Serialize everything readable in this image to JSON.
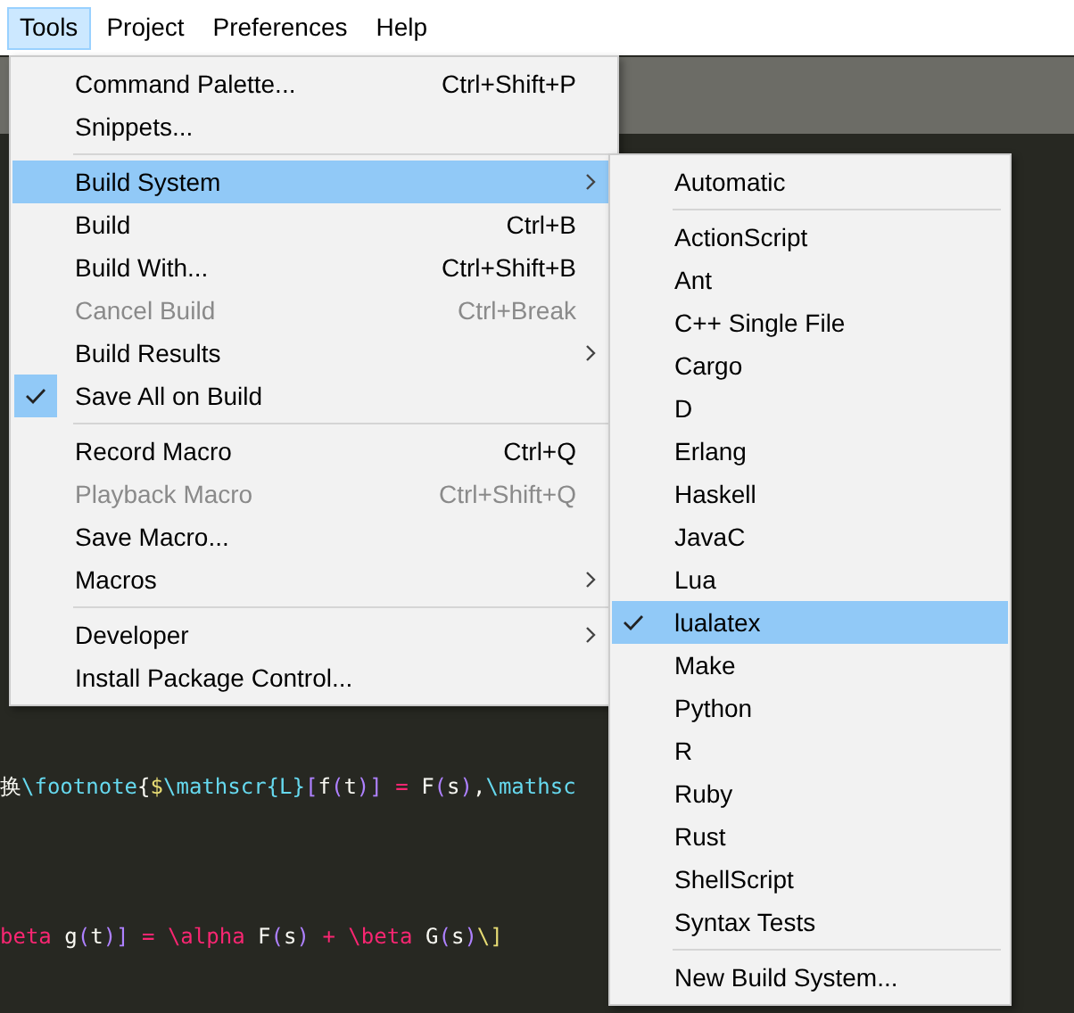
{
  "menubar": [
    {
      "label": "Tools",
      "selected": true
    },
    {
      "label": "Project",
      "selected": false
    },
    {
      "label": "Preferences",
      "selected": false
    },
    {
      "label": "Help",
      "selected": false
    }
  ],
  "editor": {
    "lines": [
      {
        "tokens": [
          {
            "text": "换",
            "color": "#f8f8f2"
          },
          {
            "text": "\\footnote",
            "color": "#66d9ef"
          },
          {
            "text": "{",
            "color": "#f8f8f2"
          },
          {
            "text": "$",
            "color": "#e6db74"
          },
          {
            "text": "\\mathscr",
            "color": "#66d9ef"
          },
          {
            "text": "{L}",
            "color": "#66d9ef"
          },
          {
            "text": "[",
            "color": "#ae81ff"
          },
          {
            "text": "f",
            "color": "#f8f8f2"
          },
          {
            "text": "(",
            "color": "#ae81ff"
          },
          {
            "text": "t",
            "color": "#f8f8f2"
          },
          {
            "text": ")]",
            "color": "#ae81ff"
          },
          {
            "text": " = ",
            "color": "#f92672"
          },
          {
            "text": "F",
            "color": "#f8f8f2"
          },
          {
            "text": "(",
            "color": "#ae81ff"
          },
          {
            "text": "s",
            "color": "#f8f8f2"
          },
          {
            "text": ")",
            "color": "#ae81ff"
          },
          {
            "text": ",",
            "color": "#f8f8f2"
          },
          {
            "text": "\\mathsc",
            "color": "#66d9ef"
          }
        ]
      },
      {
        "tokens": [
          {
            "text": "beta",
            "color": "#f92672"
          },
          {
            "text": " g",
            "color": "#f8f8f2"
          },
          {
            "text": "(",
            "color": "#ae81ff"
          },
          {
            "text": "t",
            "color": "#f8f8f2"
          },
          {
            "text": ")]",
            "color": "#ae81ff"
          },
          {
            "text": " = \\alpha",
            "color": "#f92672"
          },
          {
            "text": " F",
            "color": "#f8f8f2"
          },
          {
            "text": "(",
            "color": "#ae81ff"
          },
          {
            "text": "s",
            "color": "#f8f8f2"
          },
          {
            "text": ")",
            "color": "#ae81ff"
          },
          {
            "text": " + \\beta",
            "color": "#f92672"
          },
          {
            "text": " G",
            "color": "#f8f8f2"
          },
          {
            "text": "(",
            "color": "#ae81ff"
          },
          {
            "text": "s",
            "color": "#f8f8f2"
          },
          {
            "text": ")",
            "color": "#ae81ff"
          },
          {
            "text": "\\]",
            "color": "#e6db74"
          }
        ]
      }
    ]
  },
  "tools_menu": [
    {
      "kind": "item",
      "label": "Command Palette...",
      "shortcut": "Ctrl+Shift+P",
      "selected": false,
      "disabled": false,
      "checked": false,
      "submenu": false
    },
    {
      "kind": "item",
      "label": "Snippets...",
      "selected": false,
      "disabled": false,
      "checked": false,
      "submenu": false
    },
    {
      "kind": "separator"
    },
    {
      "kind": "item",
      "label": "Build System",
      "selected": true,
      "disabled": false,
      "checked": false,
      "submenu": true
    },
    {
      "kind": "item",
      "label": "Build",
      "shortcut": "Ctrl+B",
      "selected": false,
      "disabled": false,
      "checked": false,
      "submenu": false
    },
    {
      "kind": "item",
      "label": "Build With...",
      "shortcut": "Ctrl+Shift+B",
      "selected": false,
      "disabled": false,
      "checked": false,
      "submenu": false
    },
    {
      "kind": "item",
      "label": "Cancel Build",
      "shortcut": "Ctrl+Break",
      "selected": false,
      "disabled": true,
      "checked": false,
      "submenu": false
    },
    {
      "kind": "item",
      "label": "Build Results",
      "selected": false,
      "disabled": false,
      "checked": false,
      "submenu": true
    },
    {
      "kind": "item",
      "label": "Save All on Build",
      "selected": false,
      "disabled": false,
      "checked": true,
      "submenu": false
    },
    {
      "kind": "separator"
    },
    {
      "kind": "item",
      "label": "Record Macro",
      "shortcut": "Ctrl+Q",
      "selected": false,
      "disabled": false,
      "checked": false,
      "submenu": false
    },
    {
      "kind": "item",
      "label": "Playback Macro",
      "shortcut": "Ctrl+Shift+Q",
      "selected": false,
      "disabled": true,
      "checked": false,
      "submenu": false
    },
    {
      "kind": "item",
      "label": "Save Macro...",
      "selected": false,
      "disabled": false,
      "checked": false,
      "submenu": false
    },
    {
      "kind": "item",
      "label": "Macros",
      "selected": false,
      "disabled": false,
      "checked": false,
      "submenu": true
    },
    {
      "kind": "separator"
    },
    {
      "kind": "item",
      "label": "Developer",
      "selected": false,
      "disabled": false,
      "checked": false,
      "submenu": true
    },
    {
      "kind": "item",
      "label": "Install Package Control...",
      "selected": false,
      "disabled": false,
      "checked": false,
      "submenu": false
    }
  ],
  "build_system_menu": [
    {
      "kind": "item",
      "label": "Automatic",
      "selected": false,
      "checked": false
    },
    {
      "kind": "separator"
    },
    {
      "kind": "item",
      "label": "ActionScript",
      "selected": false,
      "checked": false
    },
    {
      "kind": "item",
      "label": "Ant",
      "selected": false,
      "checked": false
    },
    {
      "kind": "item",
      "label": "C++ Single File",
      "selected": false,
      "checked": false
    },
    {
      "kind": "item",
      "label": "Cargo",
      "selected": false,
      "checked": false
    },
    {
      "kind": "item",
      "label": "D",
      "selected": false,
      "checked": false
    },
    {
      "kind": "item",
      "label": "Erlang",
      "selected": false,
      "checked": false
    },
    {
      "kind": "item",
      "label": "Haskell",
      "selected": false,
      "checked": false
    },
    {
      "kind": "item",
      "label": "JavaC",
      "selected": false,
      "checked": false
    },
    {
      "kind": "item",
      "label": "Lua",
      "selected": false,
      "checked": false
    },
    {
      "kind": "item",
      "label": "lualatex",
      "selected": true,
      "checked": true
    },
    {
      "kind": "item",
      "label": "Make",
      "selected": false,
      "checked": false
    },
    {
      "kind": "item",
      "label": "Python",
      "selected": false,
      "checked": false
    },
    {
      "kind": "item",
      "label": "R",
      "selected": false,
      "checked": false
    },
    {
      "kind": "item",
      "label": "Ruby",
      "selected": false,
      "checked": false
    },
    {
      "kind": "item",
      "label": "Rust",
      "selected": false,
      "checked": false
    },
    {
      "kind": "item",
      "label": "ShellScript",
      "selected": false,
      "checked": false
    },
    {
      "kind": "item",
      "label": "Syntax Tests",
      "selected": false,
      "checked": false
    },
    {
      "kind": "separator"
    },
    {
      "kind": "item",
      "label": "New Build System...",
      "selected": false,
      "checked": false
    }
  ]
}
